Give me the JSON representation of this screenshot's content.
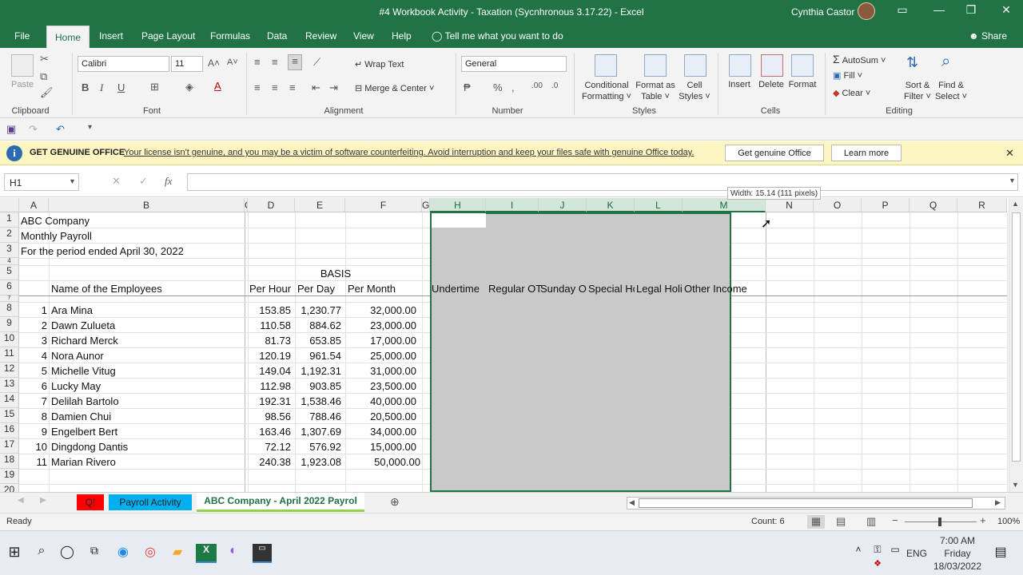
{
  "titlebar": {
    "title": "#4 Workbook Activity - Taxation (Sycnhronous 3.17.22)  -  Excel",
    "user": "Cynthia Castor"
  },
  "menu": {
    "tabs": [
      "File",
      "Home",
      "Insert",
      "Page Layout",
      "Formulas",
      "Data",
      "Review",
      "View",
      "Help"
    ],
    "tell_me": "Tell me what you want to do",
    "share": "Share"
  },
  "ribbon": {
    "clipboard": {
      "paste": "Paste",
      "label": "Clipboard"
    },
    "font": {
      "name": "Calibri",
      "size": "11",
      "label": "Font"
    },
    "alignment": {
      "wrap": "Wrap Text",
      "merge": "Merge & Center",
      "label": "Alignment"
    },
    "number": {
      "format": "General",
      "label": "Number"
    },
    "styles": {
      "conditional": "Conditional",
      "formatting": "Formatting",
      "format_as": "Format as",
      "table": "Table",
      "cell": "Cell",
      "cell_styles": "Styles",
      "label": "Styles"
    },
    "cells": {
      "insert": "Insert",
      "delete": "Delete",
      "format": "Format",
      "label": "Cells"
    },
    "editing": {
      "autosum": "AutoSum",
      "fill": "Fill",
      "clear": "Clear",
      "sort": "Sort &",
      "filter": "Filter",
      "find": "Find &",
      "select": "Select",
      "label": "Editing"
    }
  },
  "notice": {
    "head": "GET GENUINE OFFICE",
    "message": "Your license isn't genuine, and you may be a victim of software counterfeiting. Avoid interruption and keep your files safe with genuine Office today.",
    "primary": "Get genuine Office",
    "secondary": "Learn more"
  },
  "formula": {
    "namebox": "H1",
    "fx": "fx"
  },
  "tooltip": "Width: 15.14 (111 pixels)",
  "sheet": {
    "columns": [
      "A",
      "B",
      "C",
      "D",
      "E",
      "F",
      "G",
      "H",
      "I",
      "J",
      "K",
      "L",
      "M",
      "N",
      "O",
      "P",
      "Q",
      "R"
    ],
    "rows": [
      "1",
      "2",
      "3",
      "4",
      "5",
      "6",
      "7",
      "8",
      "9",
      "10",
      "11",
      "12",
      "13",
      "14",
      "15",
      "16",
      "17",
      "18",
      "19",
      "20"
    ],
    "company": "ABC Company",
    "subtitle": "Monthly Payroll",
    "period": "For the period ended April 30, 2022",
    "basis": "BASIS",
    "headers": {
      "name": "Name of the Employees",
      "per_hour": "Per Hour",
      "per_day": "Per Day",
      "per_month": "Per Month",
      "undertime": "Undertime",
      "regular_ot": "Regular OT",
      "sunday_ot": "Sunday O",
      "special": "Special Ho",
      "legal": "Legal Holi",
      "other": "Other Income"
    },
    "employees": [
      {
        "no": "1",
        "name": "Ara Mina",
        "hour": "153.85",
        "day": "1,230.77",
        "month": "32,000.00"
      },
      {
        "no": "2",
        "name": "Dawn Zulueta",
        "hour": "110.58",
        "day": "884.62",
        "month": "23,000.00"
      },
      {
        "no": "3",
        "name": "Richard Merck",
        "hour": "81.73",
        "day": "653.85",
        "month": "17,000.00"
      },
      {
        "no": "4",
        "name": "Nora Aunor",
        "hour": "120.19",
        "day": "961.54",
        "month": "25,000.00"
      },
      {
        "no": "5",
        "name": "Michelle Vitug",
        "hour": "149.04",
        "day": "1,192.31",
        "month": "31,000.00"
      },
      {
        "no": "6",
        "name": "Lucky May",
        "hour": "112.98",
        "day": "903.85",
        "month": "23,500.00"
      },
      {
        "no": "7",
        "name": "Delilah Bartolo",
        "hour": "192.31",
        "day": "1,538.46",
        "month": "40,000.00"
      },
      {
        "no": "8",
        "name": "Damien Chui",
        "hour": "98.56",
        "day": "788.46",
        "month": "20,500.00"
      },
      {
        "no": "9",
        "name": "Engelbert Bert",
        "hour": "163.46",
        "day": "1,307.69",
        "month": "34,000.00"
      },
      {
        "no": "10",
        "name": "Dingdong Dantis",
        "hour": "72.12",
        "day": "576.92",
        "month": "15,000.00"
      },
      {
        "no": "11",
        "name": "Marian Rivero",
        "hour": "240.38",
        "day": "1,923.08",
        "month": "50,000.00"
      }
    ]
  },
  "tabs": [
    "Q!",
    "Payroll Activity",
    "ABC Company - April 2022 Payrol"
  ],
  "status": {
    "ready": "Ready",
    "count": "Count: 6",
    "zoom": "100%"
  },
  "taskbar": {
    "time": "7:00 AM",
    "day": "Friday",
    "date": "18/03/2022",
    "lang": "ENG"
  },
  "colors": {
    "excel_green": "#217346",
    "notice_bg": "#fdf6c3",
    "selection": "#c9c9c9"
  }
}
